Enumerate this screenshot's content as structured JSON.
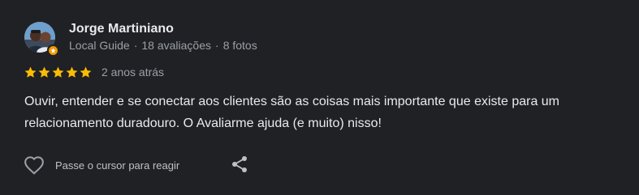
{
  "reviewer": {
    "name": "Jorge Martiniano",
    "level": "Local Guide",
    "reviews_count": "18 avaliações",
    "photos_count": "8 fotos",
    "separator": "·"
  },
  "rating": {
    "stars": 5,
    "max": 5,
    "date": "2 anos atrás"
  },
  "review_text": "Ouvir, entender e se conectar aos clientes são as coisas mais importante que existe para um relacionamento duradouro. O Avaliarme ajuda (e muito) nisso!",
  "actions": {
    "react_label": "Passe o cursor para reagir",
    "like_icon": "heart-outline-icon",
    "share_icon": "share-icon"
  },
  "colors": {
    "background": "#202124",
    "star": "#fbbc04",
    "text_primary": "#e8eaed",
    "text_secondary": "#9aa0a6",
    "badge": "#f29900"
  }
}
